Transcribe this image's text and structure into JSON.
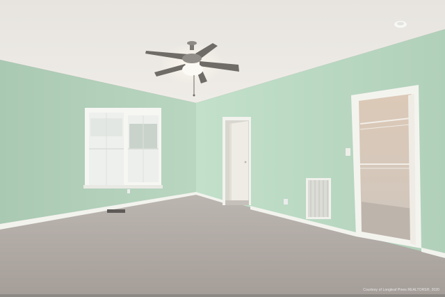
{
  "scene": {
    "description_free": true,
    "colors": {
      "ceiling": "#ece9e4",
      "wall_left": "#b5d3bd",
      "wall_right": "#bcdcc5",
      "carpet": "#b2aba6",
      "trim": "#f4f4ef",
      "door": "#efece6",
      "closet_interior": "#d8ccc0"
    }
  },
  "watermark": {
    "text": "Courtesy of Longleaf Pines REALTORS®, 2020"
  }
}
